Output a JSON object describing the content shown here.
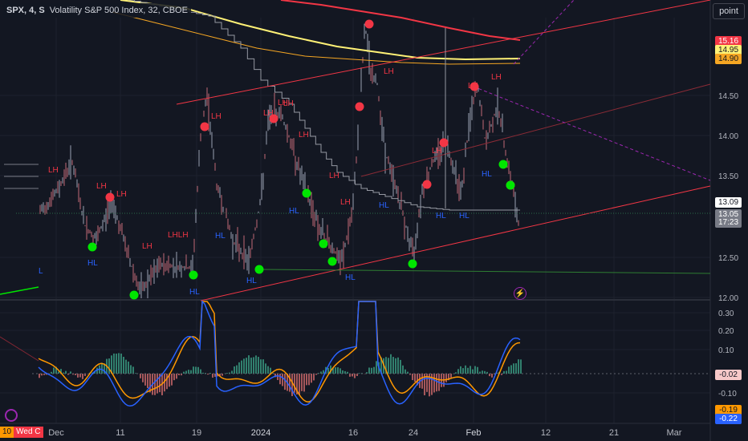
{
  "legend": {
    "symbol": "SPX, 4, S",
    "name": "Volatility S&P 500 Index, 32, CBOE"
  },
  "toolbar": {
    "point_label": "point"
  },
  "price_axis": {
    "ticks": [
      "14.50",
      "14.00",
      "13.50",
      "12.50",
      "12.00"
    ],
    "badges": [
      {
        "text": "15.16",
        "bg": "#f23645",
        "fg": "#ffffff"
      },
      {
        "text": "14.95",
        "bg": "#fff176",
        "fg": "#131722"
      },
      {
        "text": "14.90",
        "bg": "#f5a623",
        "fg": "#131722"
      },
      {
        "text": "13.09",
        "bg": "#ffffff",
        "fg": "#131722"
      },
      {
        "text": "13.05",
        "bg": "#787b86",
        "fg": "#ffffff"
      },
      {
        "text": "17:23",
        "bg": "#787b86",
        "fg": "#ffffff"
      }
    ]
  },
  "osc_axis": {
    "ticks": [
      "0.30",
      "0.20",
      "0.10",
      "-0.10"
    ],
    "badges": [
      {
        "text": "-0.02",
        "bg": "#f7c8c8",
        "fg": "#131722"
      },
      {
        "text": "-0.19",
        "bg": "#ff9800",
        "fg": "#131722"
      },
      {
        "text": "-0.22",
        "bg": "#2962ff",
        "fg": "#ffffff"
      }
    ]
  },
  "time_axis": {
    "labels": [
      "Dec",
      "11",
      "19",
      "2024",
      "16",
      "24",
      "Feb",
      "12",
      "21",
      "Mar"
    ]
  },
  "date_badge": {
    "left": "10",
    "main": "Wed C"
  },
  "markers": {
    "lh": "LH",
    "hl": "HL",
    "lhlh": "LHLH",
    "l": "L"
  },
  "colors": {
    "background": "#131722",
    "red": "#f23645",
    "green": "#00e600",
    "yellow": "#fff176",
    "orange": "#f5a623",
    "grey_line": "#b2b5be",
    "label_red": "#f23645",
    "label_blue": "#2962ff",
    "osc_blue": "#2962ff",
    "osc_orange": "#ff9800",
    "hist_green": "#26a69a",
    "hist_red": "#ef5350"
  },
  "icons": {
    "bolt": "lightning-icon",
    "logo": "tradingview-logo-icon"
  }
}
